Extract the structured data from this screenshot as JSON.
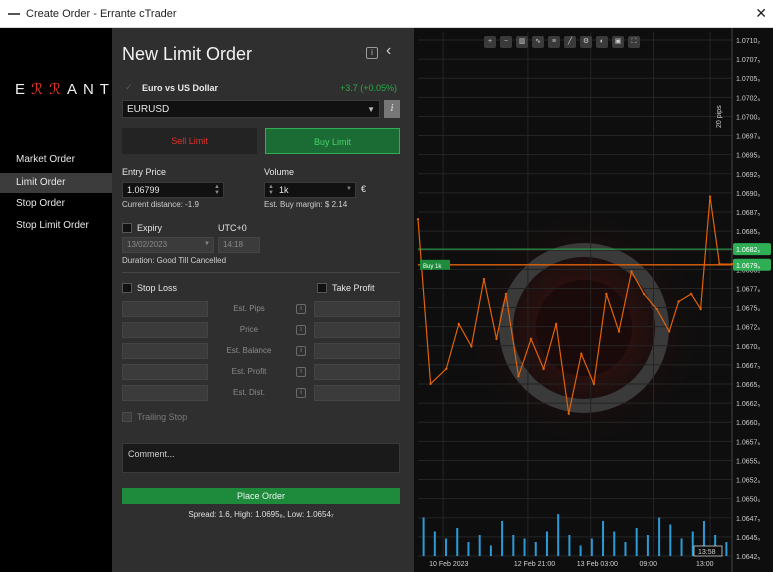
{
  "window": {
    "title": "Create Order - Errante cTrader",
    "close_glyph": "✕"
  },
  "brand": {
    "logo_a": "E",
    "logo_accent": "ℛℛ",
    "logo_b": "ANTE"
  },
  "sidebar": {
    "items": [
      {
        "label": "Market Order"
      },
      {
        "label": "Limit Order"
      },
      {
        "label": "Stop Order"
      },
      {
        "label": "Stop Limit Order"
      }
    ]
  },
  "panel": {
    "title": "New Limit Order",
    "symbol_name": "Euro vs US Dollar",
    "symbol_change": "+3.7 (+0.05%)",
    "symbol": "EURUSD",
    "sell_label": "Sell Limit",
    "buy_label": "Buy Limit",
    "entry_price_label": "Entry Price",
    "entry_price": "1.06799",
    "current_distance": "Current distance: -1.9",
    "volume_label": "Volume",
    "volume": "1k",
    "currency": "€",
    "est_margin": "Est. Buy margin: $ 2.14",
    "expiry_label": "Expiry",
    "timezone": "UTC+0",
    "expiry_date": "13/02/2023",
    "expiry_time": "14:18",
    "duration": "Duration: Good Till Cancelled",
    "stop_loss_label": "Stop Loss",
    "take_profit_label": "Take Profit",
    "est_labels": [
      "Est. Pips",
      "Price",
      "Est. Balance",
      "Est. Profit",
      "Est. Dist."
    ],
    "trailing_stop_label": "Trailing Stop",
    "comment_placeholder": "Comment...",
    "place_order_label": "Place Order",
    "spread_line": "Spread: 1.6, High: 1.0695₈, Low: 1.0654₇"
  },
  "chart_data": {
    "type": "line",
    "symbol": "EURUSD",
    "y_ticks": [
      "1.0710₂",
      "1.0707₅",
      "1.0705₀",
      "1.0702₅",
      "1.0700₀",
      "1.0697₅",
      "1.0695₀",
      "1.0692₅",
      "1.0690₀",
      "1.0687₅",
      "1.0685₀",
      "1.0682₅",
      "1.0680₀",
      "1.0677₅",
      "1.0675₀",
      "1.0672₅",
      "1.0670₀",
      "1.0667₅",
      "1.0665₀",
      "1.0662₅",
      "1.0660₀",
      "1.0657₅",
      "1.0655₀",
      "1.0652₅",
      "1.0650₀",
      "1.0647₅",
      "1.0645₀",
      "1.0642₅"
    ],
    "ylim": [
      1.0641,
      1.0711
    ],
    "x_ticks": [
      "10 Feb 2023",
      "12 Feb 21:00",
      "13 Feb 03:00",
      "09:00",
      "13:00"
    ],
    "ask_line": {
      "value": 1.0682,
      "label": "1.0682₀",
      "color": "#2fae55"
    },
    "entry_line": {
      "value": 1.06799,
      "label": "1.0679₉",
      "color": "#e0620b"
    },
    "order_tag": "Buy 1k",
    "pips_label": "20 pips",
    "crosshair_time": "13:58",
    "price_series": [
      {
        "x": 0.0,
        "y": 1.0686
      },
      {
        "x": 0.04,
        "y": 1.0664
      },
      {
        "x": 0.09,
        "y": 1.0666
      },
      {
        "x": 0.13,
        "y": 1.0672
      },
      {
        "x": 0.17,
        "y": 1.0669
      },
      {
        "x": 0.21,
        "y": 1.0678
      },
      {
        "x": 0.25,
        "y": 1.067
      },
      {
        "x": 0.28,
        "y": 1.0676
      },
      {
        "x": 0.32,
        "y": 1.0665
      },
      {
        "x": 0.36,
        "y": 1.067
      },
      {
        "x": 0.4,
        "y": 1.0666
      },
      {
        "x": 0.44,
        "y": 1.0672
      },
      {
        "x": 0.48,
        "y": 1.066
      },
      {
        "x": 0.52,
        "y": 1.0668
      },
      {
        "x": 0.56,
        "y": 1.0664
      },
      {
        "x": 0.6,
        "y": 1.0676
      },
      {
        "x": 0.64,
        "y": 1.0671
      },
      {
        "x": 0.68,
        "y": 1.0679
      },
      {
        "x": 0.72,
        "y": 1.0676
      },
      {
        "x": 0.76,
        "y": 1.0674
      },
      {
        "x": 0.8,
        "y": 1.0671
      },
      {
        "x": 0.83,
        "y": 1.0675
      },
      {
        "x": 0.87,
        "y": 1.0676
      },
      {
        "x": 0.9,
        "y": 1.0674
      },
      {
        "x": 0.93,
        "y": 1.0689
      },
      {
        "x": 0.96,
        "y": 1.068
      },
      {
        "x": 1.0,
        "y": 1.068
      }
    ],
    "volumes": [
      0.55,
      0.35,
      0.25,
      0.4,
      0.2,
      0.3,
      0.15,
      0.5,
      0.3,
      0.25,
      0.2,
      0.35,
      0.6,
      0.3,
      0.15,
      0.25,
      0.5,
      0.35,
      0.2,
      0.4,
      0.3,
      0.55,
      0.45,
      0.25,
      0.35,
      0.5,
      0.3,
      0.2
    ],
    "series_color": "#e0620b",
    "volume_color": "#2b9bd8"
  }
}
